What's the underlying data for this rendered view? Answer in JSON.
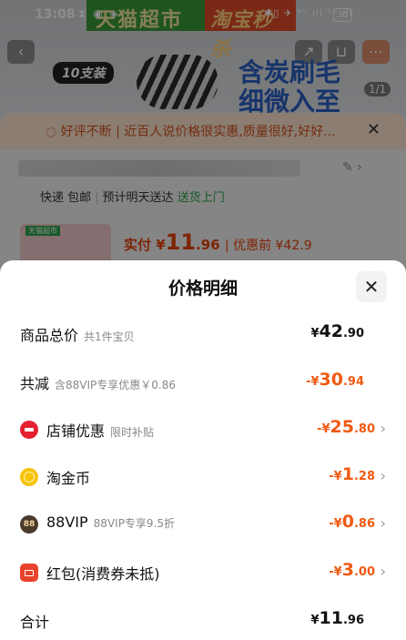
{
  "status_bar": {
    "time": "13:08",
    "left_icons": "⧗ ◉ ◈",
    "right_icons": "✱▯ ✈ ⁴ᴳ ıll ⁵ᴳ ıll",
    "battery": "35"
  },
  "background": {
    "brand_left": "天猫超市",
    "brand_right": "淘宝秒杀",
    "badge": "10支装",
    "promo_line1": "含炭刷毛",
    "promo_line2": "细微入至",
    "pager": "1/1",
    "hint_text": "好评不断 | 近百人说价格很实惠,质量很好,好好...",
    "delivery": {
      "a": "快递 包邮",
      "b": "预计明天送达",
      "c": "送货上门"
    },
    "product_tag": "天猫超市",
    "pay": {
      "prefix": "实付",
      "currency": "¥",
      "amount": "11",
      "decimal": ".96",
      "before": "优惠前 ¥42.9"
    }
  },
  "sheet": {
    "title": "价格明细",
    "close_glyph": "✕",
    "rows": [
      {
        "label": "商品总价",
        "sub": "共1件宝贝",
        "currency": "¥",
        "int": "42",
        "dec": ".90",
        "color": "black",
        "chevron": false
      },
      {
        "label": "共减",
        "sub": "含88VIP专享优惠￥0.86",
        "currency": "-¥",
        "int": "30",
        "dec": ".94",
        "color": "orange",
        "chevron": false
      },
      {
        "label": "店铺优惠",
        "sub": "限时补贴",
        "currency": "-¥",
        "int": "25",
        "dec": ".80",
        "color": "orange",
        "chevron": true,
        "icon": "shop-icon"
      },
      {
        "label": "淘金币",
        "sub": "",
        "currency": "-¥",
        "int": "1",
        "dec": ".28",
        "color": "orange",
        "chevron": true,
        "icon": "coin-icon"
      },
      {
        "label": "88VIP",
        "sub": "88VIP专享9.5折",
        "currency": "-¥",
        "int": "0",
        "dec": ".86",
        "color": "orange",
        "chevron": true,
        "icon": "vip-icon",
        "icon_text": "88"
      },
      {
        "label": "红包(消费券未抵)",
        "sub": "",
        "currency": "-¥",
        "int": "3",
        "dec": ".00",
        "color": "orange",
        "chevron": true,
        "icon": "red-packet-icon"
      },
      {
        "label": "合计",
        "sub": "",
        "currency": "¥",
        "int": "11",
        "dec": ".96",
        "color": "black",
        "chevron": false
      }
    ]
  },
  "colors": {
    "accent_orange": "#f05a12",
    "hint_orange": "#d2541c",
    "green": "#2aa34a"
  }
}
